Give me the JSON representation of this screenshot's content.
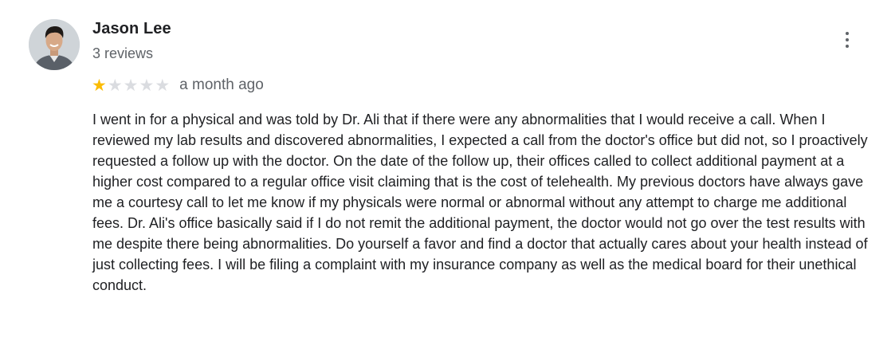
{
  "review": {
    "author": "Jason Lee",
    "meta": "3 reviews",
    "rating": 1,
    "max_rating": 5,
    "time": "a month ago",
    "text": "I went in for a physical and was told by Dr. Ali that if there were any abnormalities that I would receive a call. When I reviewed my lab results and discovered abnormalities, I expected a call from the doctor's office but did not, so I proactively requested a follow up with the doctor. On the date of the follow up, their offices called to collect additional payment at a higher cost compared to a regular office visit claiming that is the cost of telehealth. My previous doctors have always gave me a courtesy call to let me know if my physicals were normal or abnormal without any attempt to charge me additional fees. Dr. Ali's office basically said if I do not remit the additional payment, the doctor would not go over the test results with me despite there being abnormalities. Do yourself a favor and find a doctor that actually cares about your health instead of just collecting fees. I will be filing a complaint with my insurance company as well as the medical board for their unethical conduct."
  },
  "icons": {
    "avatar": "profile-photo",
    "more": "more-vert-icon",
    "star": "star-icon"
  },
  "colors": {
    "star_filled": "#fbbc04",
    "star_empty": "#dadce0",
    "secondary_text": "#5f6368",
    "primary_text": "#202124"
  }
}
